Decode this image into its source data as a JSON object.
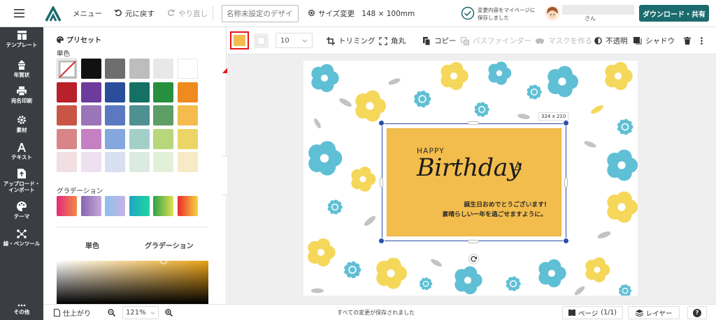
{
  "topbar": {
    "menu_label": "メニュー",
    "undo_label": "元に戻す",
    "redo_label": "やり直し",
    "design_name_placeholder": "名称未設定のデザイン",
    "size_change_label": "サイズ変更",
    "size_value": "148 × 100mm",
    "save_status_line1": "変更内容をマイページに",
    "save_status_line2": "保存しました",
    "user_suffix": "さん",
    "download_button": "ダウンロード・共有"
  },
  "sidebar": {
    "items": [
      {
        "label": "テンプレート",
        "icon": "template-icon"
      },
      {
        "label": "年賀状",
        "icon": "new-year-card-icon"
      },
      {
        "label": "宛名印刷",
        "icon": "printer-icon"
      },
      {
        "label": "素材",
        "icon": "material-icon"
      },
      {
        "label": "テキスト",
        "icon": "text-icon"
      },
      {
        "label1": "アップロード・",
        "label2": "インポート",
        "icon": "upload-icon"
      },
      {
        "label": "テーマ",
        "icon": "palette-icon"
      },
      {
        "label": "線・ペンツール",
        "icon": "pen-tool-icon"
      },
      {
        "label": "その他",
        "icon": "more-icon"
      }
    ]
  },
  "panel": {
    "preset_title": "プリセット",
    "solid_label": "単色",
    "gradient_label": "グラデーション",
    "tab_solid": "単色",
    "tab_gradient": "グラデーション",
    "solid_rows": [
      [
        "none",
        "#111111",
        "#6e6e6e",
        "#bdbdbd",
        "#e8e8e8",
        "#ffffff"
      ],
      [
        "#b8202a",
        "#6d3b9b",
        "#2a4e9c",
        "#157163",
        "#27903f",
        "#ef8a1e"
      ],
      [
        "#c95645",
        "#9b75b8",
        "#5a79c0",
        "#4f9092",
        "#5c9e63",
        "#f3bc4d"
      ],
      [
        "#d98588",
        "#c580c3",
        "#84a8dd",
        "#a3cfc9",
        "#b8d77b",
        "#ebd567"
      ],
      [
        "#f1dfe3",
        "#efe0f1",
        "#d8dff1",
        "#dcebe2",
        "#e2f0d8",
        "#f7eac7"
      ]
    ],
    "gradients": [
      [
        "#e4287a",
        "#f08a47"
      ],
      [
        "#8a63b3",
        "#c4a9d9"
      ],
      [
        "#8cc1ea",
        "#c8b3e6"
      ],
      [
        "#1ea6c4",
        "#1fd5a0"
      ],
      [
        "#2ca349",
        "#e2e052"
      ],
      [
        "#ea2b2b",
        "#f6d541"
      ]
    ]
  },
  "toolbar2": {
    "font_size_value": "10",
    "trim_label": "トリミング",
    "corner_label": "角丸",
    "copy_label": "コピー",
    "pathfinder_label": "パスファインダー",
    "mask_label": "マスクを作る",
    "opacity_label": "不透明",
    "shadow_label": "シャドウ",
    "selected_fill_color": "#f3bd4d",
    "selected_stroke_color": "#eeeeee"
  },
  "canvas": {
    "dimension_badge": "324 x 210",
    "card_happy": "HAPPY",
    "card_birthday": "Birthday",
    "card_message_line1": "誕生日おめでとうございます!",
    "card_message_line2": "素晴らしい一年を過ごせますように。",
    "card_color": "#f3bd4d"
  },
  "bottombar": {
    "finish_label": "仕上がり",
    "zoom_value": "121%",
    "save_status": "すべての変更が保存されました",
    "page_label": "ページ",
    "page_count": "(1/1)",
    "layer_label": "レイヤー",
    "help_label": "?"
  },
  "colors": {
    "accent": "#1b6b6e",
    "sidebar_bg": "#3a3d42",
    "arrow_red": "#e8131b"
  }
}
